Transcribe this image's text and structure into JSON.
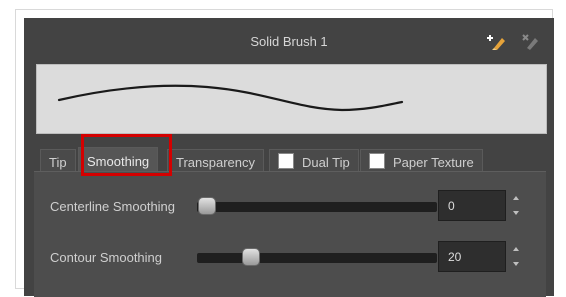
{
  "window": {
    "title": "Solid Brush 1"
  },
  "toolbar": {
    "new_brush_icon": "new-brush-icon",
    "delete_brush_icon": "delete-brush-icon"
  },
  "tabs": [
    {
      "label": "Tip",
      "active": false,
      "checkbox": false
    },
    {
      "label": "Smoothing",
      "active": true,
      "checkbox": false
    },
    {
      "label": "Transparency",
      "active": false,
      "checkbox": false
    },
    {
      "label": "Dual Tip",
      "active": false,
      "checkbox": true,
      "checked": false
    },
    {
      "label": "Paper Texture",
      "active": false,
      "checkbox": true,
      "checked": false
    }
  ],
  "smoothing": {
    "centerline": {
      "label": "Centerline Smoothing",
      "value": "0",
      "slider_fraction": 0.0
    },
    "contour": {
      "label": "Contour Smoothing",
      "value": "20",
      "slider_fraction": 0.2
    }
  },
  "colors": {
    "highlight": "#d40000",
    "panel": "#434343"
  }
}
